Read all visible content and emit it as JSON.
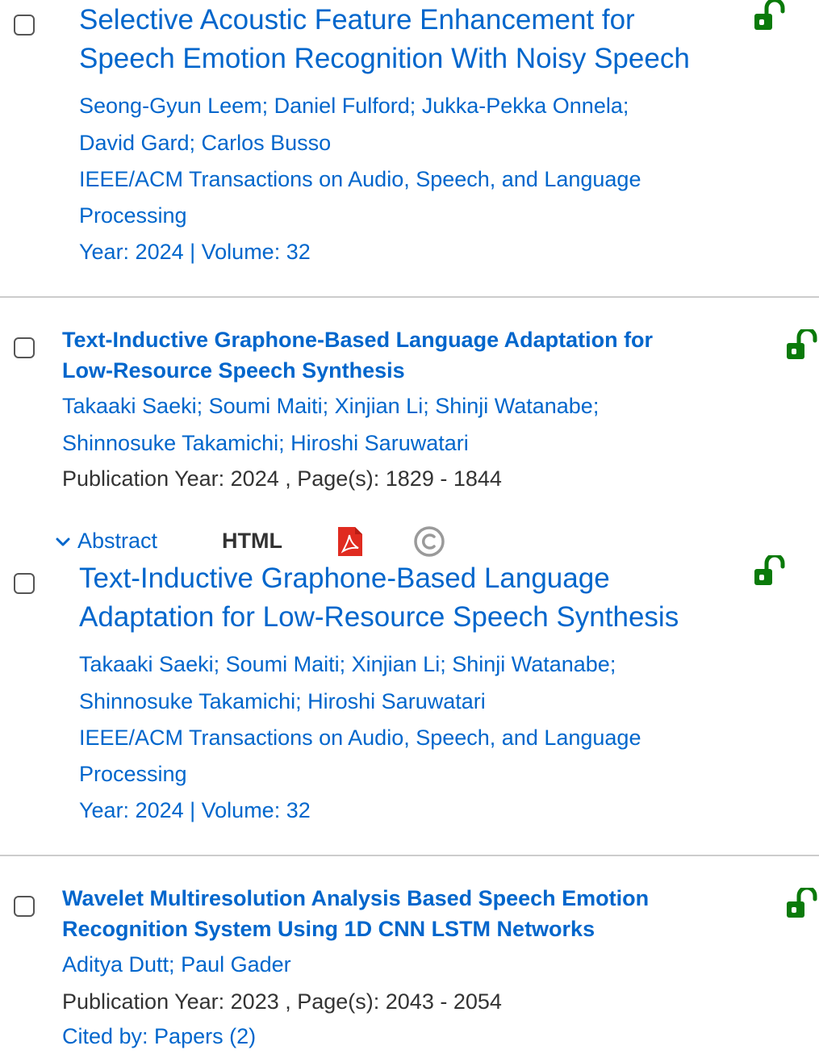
{
  "popup1": {
    "title_line1": "Selective Acoustic Feature Enhancement for",
    "title_line2": "Speech Emotion Recognition With Noisy Speech",
    "authors_line1": "Seong-Gyun Leem; Daniel Fulford; Jukka-Pekka Onnela;",
    "authors_line2": "David Gard; Carlos Busso",
    "journal_line1": "IEEE/ACM Transactions on Audio, Speech, and Language",
    "journal_line2": "Processing",
    "meta": "Year: 2024  | Volume: 32"
  },
  "result1": {
    "title_line1": "Text-Inductive Graphone-Based Language Adaptation for",
    "title_line2": "Low-Resource Speech Synthesis",
    "authors_line1": "Takaaki Saeki; Soumi Maiti; Xinjian Li; Shinji Watanabe;",
    "authors_line2": "Shinnosuke Takamichi; Hiroshi Saruwatari",
    "pub_info": "Publication Year: 2024 , Page(s): 1829  -  1844",
    "actions": {
      "abstract_label": "Abstract",
      "html_label": "HTML"
    }
  },
  "popup2": {
    "title_line1": "Text-Inductive Graphone-Based Language",
    "title_line2": "Adaptation for Low-Resource Speech Synthesis",
    "authors_line1": "Takaaki Saeki; Soumi Maiti; Xinjian Li; Shinji Watanabe;",
    "authors_line2": "Shinnosuke Takamichi; Hiroshi Saruwatari",
    "journal_line1": "IEEE/ACM Transactions on Audio, Speech, and Language",
    "journal_line2": "Processing",
    "meta": "Year: 2024  | Volume: 32"
  },
  "result2": {
    "title_line1": "Wavelet Multiresolution Analysis Based Speech Emotion",
    "title_line2": "Recognition System Using 1D CNN LSTM Networks",
    "authors_line1": "Aditya Dutt; Paul Gader",
    "pub_info": "Publication Year: 2023 , Page(s): 2043  -  2054",
    "cited_by": "Cited by: Papers (2)"
  },
  "colors": {
    "link": "#0066cc",
    "open_access": "#0a7a0a",
    "pdf": "#e02b20",
    "divider": "#cccccc"
  },
  "icons": [
    "checkbox",
    "open-access-lock-icon",
    "chevron-down-icon",
    "pdf-icon",
    "copyright-icon"
  ]
}
